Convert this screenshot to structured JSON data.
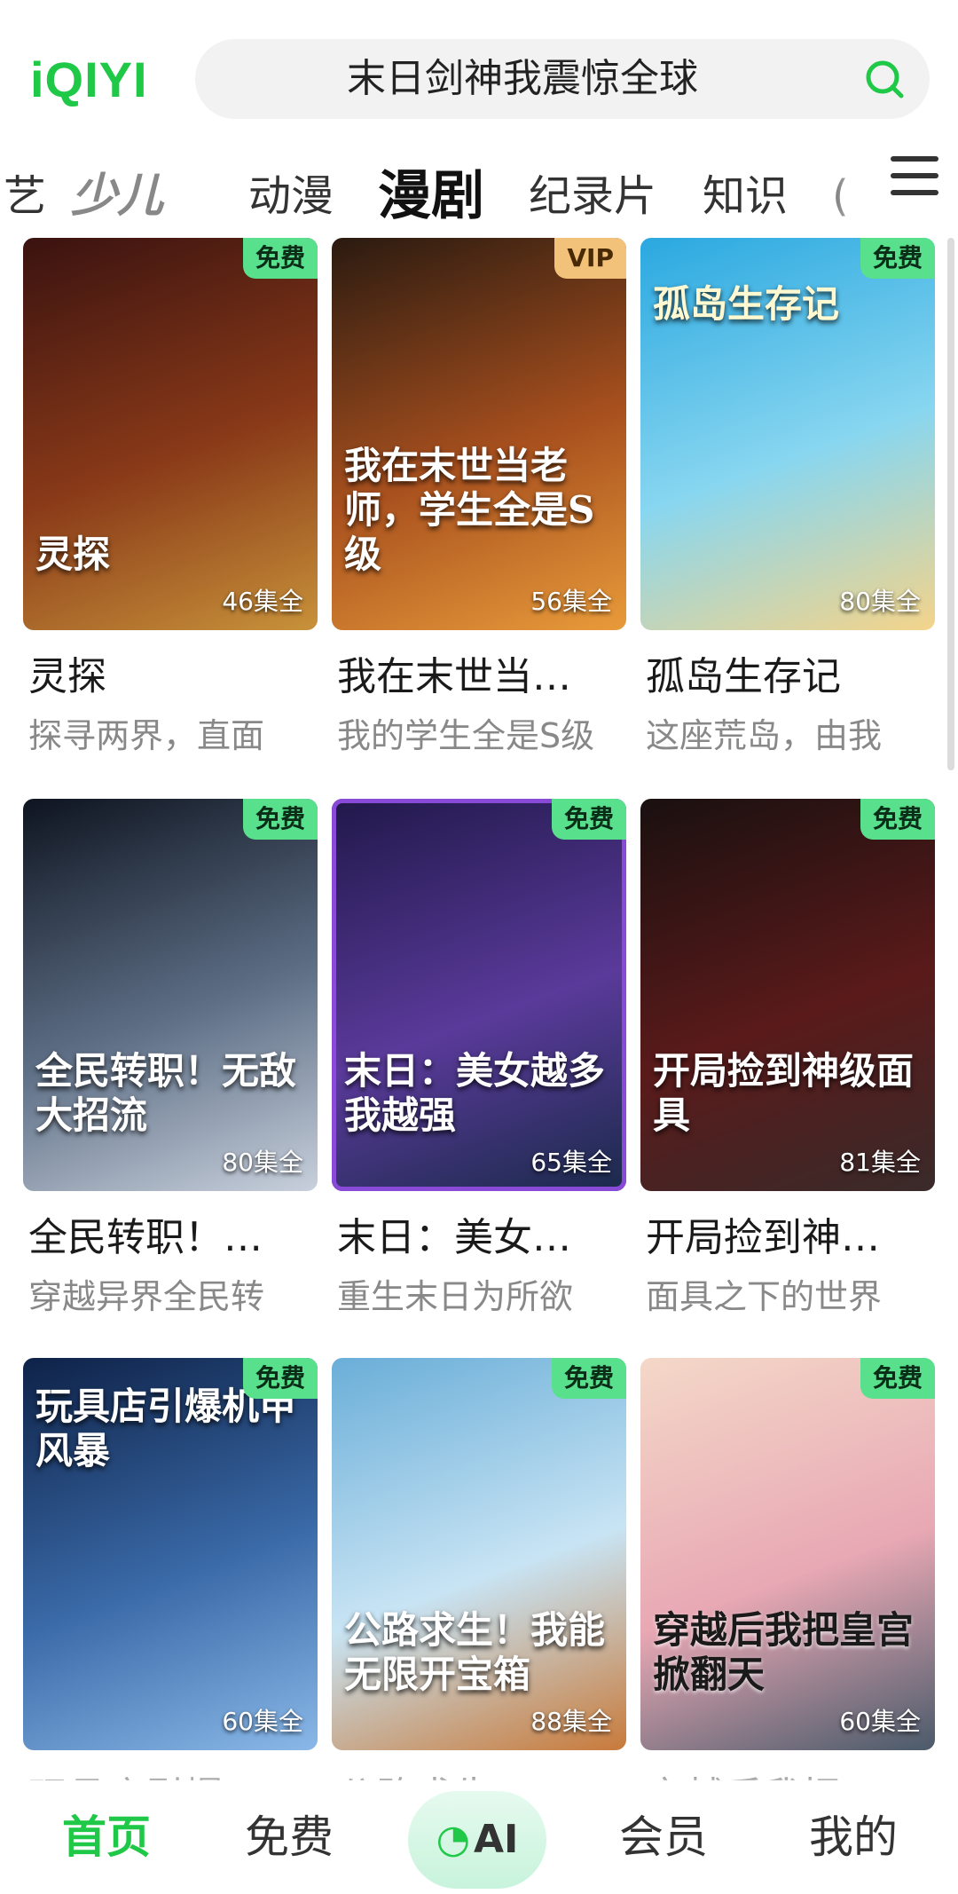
{
  "header": {
    "logo": "iQIYI",
    "search_text": "末日剑神我震惊全球"
  },
  "tabs": [
    {
      "label": "艺"
    },
    {
      "label": "少儿"
    },
    {
      "label": "动漫"
    },
    {
      "label": "漫剧"
    },
    {
      "label": "纪录片"
    },
    {
      "label": "知识"
    },
    {
      "label": "("
    }
  ],
  "cards": [
    {
      "title": "灵探",
      "desc": "探寻两界，直面",
      "badge": "免费",
      "episodes": "46集全",
      "poster_text": "灵探",
      "colors": [
        "#3a1210",
        "#8a3a18",
        "#c8923a"
      ]
    },
    {
      "title": "我在末世当…",
      "desc": "我的学生全是S级",
      "badge": "VIP",
      "episodes": "56集全",
      "poster_text": "我在末世当老师，学生全是S级",
      "colors": [
        "#2a1a10",
        "#a8501e",
        "#e89b3a"
      ]
    },
    {
      "title": "孤岛生存记",
      "desc": "这座荒岛，由我",
      "badge": "免费",
      "episodes": "80集全",
      "poster_text": "孤岛生存记",
      "colors": [
        "#2aa8e0",
        "#88d6f0",
        "#f4d48a"
      ]
    },
    {
      "title": "全民转职！…",
      "desc": "穿越异界全民转",
      "badge": "免费",
      "episodes": "80集全",
      "poster_text": "全民转职！无敌大招流",
      "colors": [
        "#0e1420",
        "#5e6f86",
        "#c8d0dc"
      ]
    },
    {
      "title": "末日：美女…",
      "desc": "重生末日为所欲",
      "badge": "免费",
      "episodes": "65集全",
      "poster_text": "末日：美女越多我越强",
      "colors": [
        "#20184a",
        "#5a3a9a",
        "#1a2a4a"
      ]
    },
    {
      "title": "开局捡到神…",
      "desc": "面具之下的世界",
      "badge": "免费",
      "episodes": "81集全",
      "poster_text": "开局捡到神级面具",
      "colors": [
        "#1a1010",
        "#5a1a1a",
        "#3a2a2a"
      ]
    },
    {
      "title": "玩具店引爆…",
      "desc": "",
      "badge": "免费",
      "episodes": "60集全",
      "poster_text": "玩具店引爆机甲风暴",
      "colors": [
        "#0e2248",
        "#3a6aa8",
        "#8ab8e8"
      ]
    },
    {
      "title": "公路求生！…",
      "desc": "",
      "badge": "免费",
      "episodes": "88集全",
      "poster_text": "公路求生！我能无限开宝箱",
      "colors": [
        "#6aaed8",
        "#c8e4f4",
        "#c87a3a"
      ]
    },
    {
      "title": "穿越后我把…",
      "desc": "",
      "badge": "免费",
      "episodes": "60集全",
      "poster_text": "穿越后我把皇宫掀翻天",
      "colors": [
        "#f4d8c8",
        "#e8a8b4",
        "#4a5a6a"
      ]
    }
  ],
  "bottom_nav": {
    "home": "首页",
    "free": "免费",
    "ai": "AI",
    "member": "会员",
    "mine": "我的"
  },
  "accent_color": "#1fc846"
}
